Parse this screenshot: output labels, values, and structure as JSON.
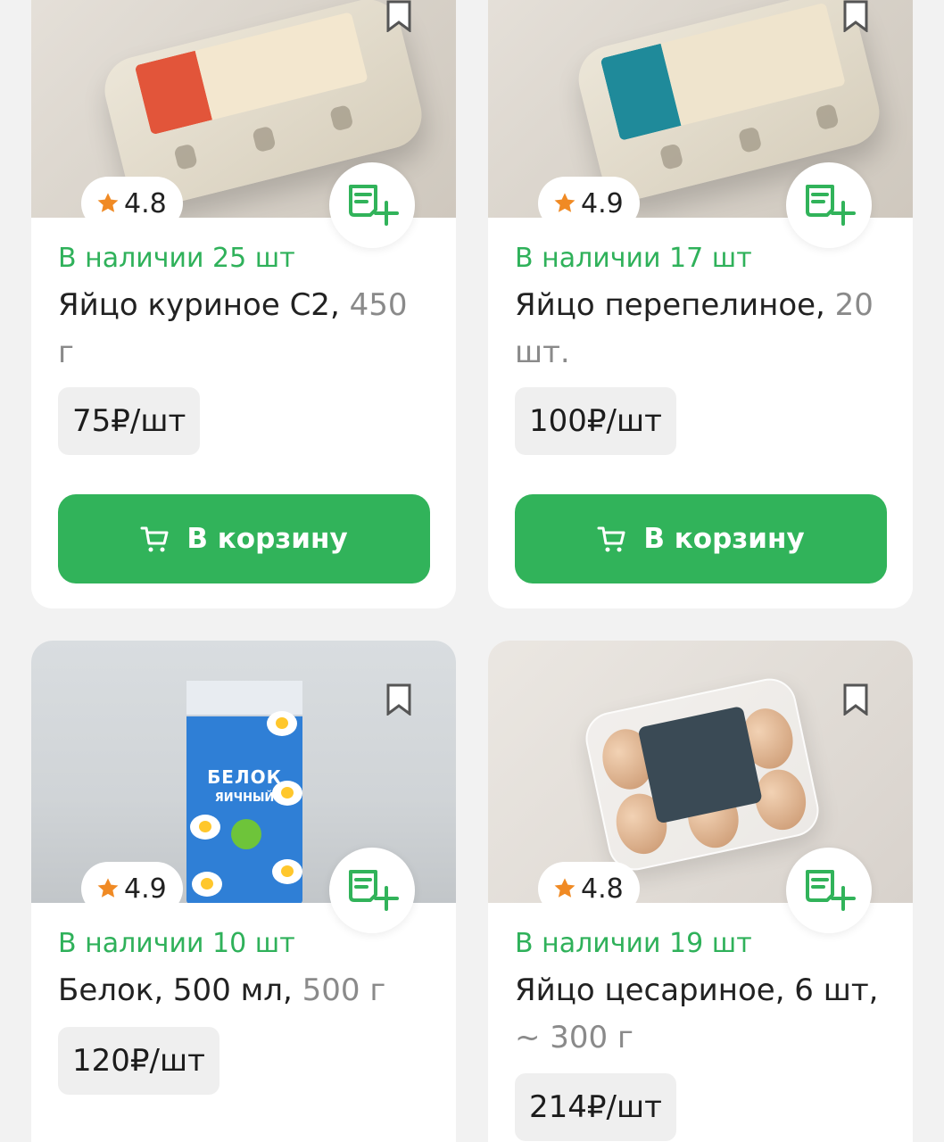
{
  "products": [
    {
      "rating": "4.8",
      "stock": "В наличии 25 шт",
      "name": "Яйцо куриное С2,",
      "weight": "450 г",
      "price": "75₽/шт",
      "cart_label": "В корзину",
      "image_icon": "egg-carton-image"
    },
    {
      "rating": "4.9",
      "stock": "В наличии 17 шт",
      "name": "Яйцо перепелиное,",
      "weight": "20 шт.",
      "price": "100₽/шт",
      "cart_label": "В корзину",
      "image_icon": "quail-egg-carton-image"
    },
    {
      "rating": "4.9",
      "stock": "В наличии 10 шт",
      "name": "Белок, 500 мл,",
      "weight": "500 г",
      "price": "120₽/шт",
      "image_icon": "egg-white-pack-image",
      "pack_title": "БЕЛОК",
      "pack_subtitle": "ЯИЧНЫЙ"
    },
    {
      "rating": "4.8",
      "stock": "В наличии 19 шт",
      "name": "Яйцо цесариное, 6 шт,",
      "weight": "~ 300 г",
      "price": "214₽/шт",
      "image_icon": "guinea-egg-box-image"
    }
  ],
  "colors": {
    "accent": "#31b35a",
    "stock_text": "#2fb15a",
    "star": "#f08a24",
    "price_bg": "#efefef"
  }
}
